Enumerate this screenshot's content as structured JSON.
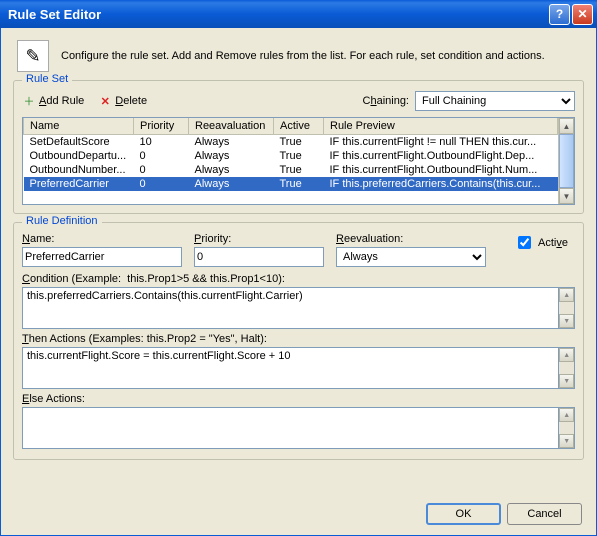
{
  "window": {
    "title": "Rule Set Editor",
    "intro_text": "Configure the rule set. Add and Remove rules from the list. For each rule, set condition and actions."
  },
  "ruleset": {
    "group_title": "Rule Set",
    "add_label": "Add Rule",
    "delete_label": "Delete",
    "chaining_label": "Chaining:",
    "chaining_value": "Full Chaining",
    "columns": {
      "name": "Name",
      "priority": "Priority",
      "reevaluation": "Reeavaluation",
      "active": "Active",
      "preview": "Rule Preview"
    },
    "rows": [
      {
        "name": "SetDefaultScore",
        "priority": "10",
        "reeval": "Always",
        "active": "True",
        "preview": "IF this.currentFlight != null THEN this.cur...",
        "selected": false
      },
      {
        "name": "OutboundDepartu...",
        "priority": "0",
        "reeval": "Always",
        "active": "True",
        "preview": "IF this.currentFlight.OutboundFlight.Dep...",
        "selected": false
      },
      {
        "name": "OutboundNumber...",
        "priority": "0",
        "reeval": "Always",
        "active": "True",
        "preview": "IF this.currentFlight.OutboundFlight.Num...",
        "selected": false
      },
      {
        "name": "PreferredCarrier",
        "priority": "0",
        "reeval": "Always",
        "active": "True",
        "preview": "IF this.preferredCarriers.Contains(this.cur...",
        "selected": true
      }
    ]
  },
  "ruledef": {
    "group_title": "Rule Definition",
    "name_label": "Name:",
    "name_value": "PreferredCarrier",
    "priority_label": "Priority:",
    "priority_value": "0",
    "reeval_label": "Reevaluation:",
    "reeval_value": "Always",
    "active_label": "Active",
    "active_checked": true,
    "condition_label": "Condition (Example:  this.Prop1>5 && this.Prop1<10):",
    "condition_value": "this.preferredCarriers.Contains(this.currentFlight.Carrier)",
    "then_label": "Then Actions (Examples: this.Prop2 = \"Yes\", Halt):",
    "then_value": "this.currentFlight.Score = this.currentFlight.Score + 10",
    "else_label": "Else Actions:",
    "else_value": ""
  },
  "footer": {
    "ok": "OK",
    "cancel": "Cancel"
  }
}
